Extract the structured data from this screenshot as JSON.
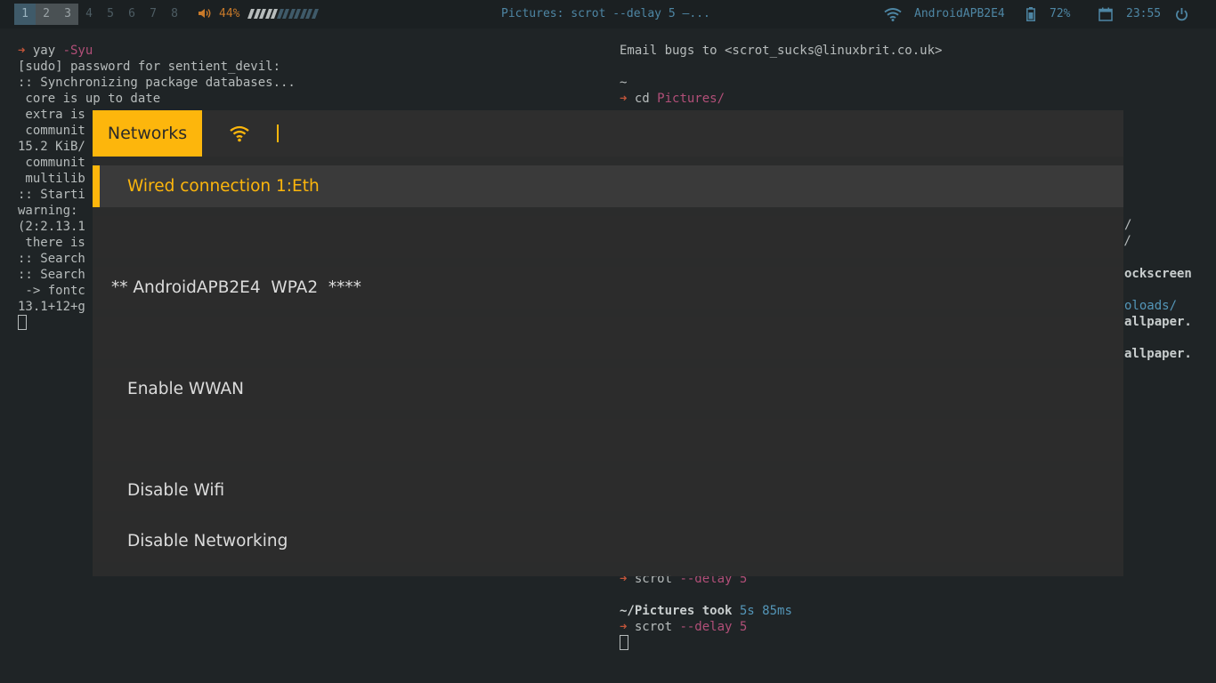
{
  "topbar": {
    "workspaces": [
      "1",
      "2",
      "3",
      "4",
      "5",
      "6",
      "7",
      "8"
    ],
    "volume": "44%",
    "volume_level": 0.44,
    "window_title": "Pictures: scrot --delay 5 —...",
    "ssid": "AndroidAPB2E4",
    "battery": "72%",
    "clock": "23:55",
    "colors": {
      "accent": "#4e86a4",
      "volume": "#c97a2a"
    }
  },
  "term_left": {
    "l1_cmd": "yay ",
    "l1_arg": "-Syu",
    "lines": [
      "[sudo] password for sentient_devil:",
      ":: Synchronizing package databases...",
      " core is up to date",
      " extra is",
      " communit",
      "15.2 KiB/",
      " communit",
      " multilib",
      ":: Starti",
      "warning:",
      "(2:2.13.1",
      " there is",
      ":: Search",
      ":: Search",
      " -> fontc",
      "13.1+12+g"
    ]
  },
  "term_right": {
    "email": "Email bugs to <scrot_sucks@linuxbrit.co.uk>",
    "tilde": "~",
    "cd_cmd": "cd ",
    "cd_arg": "Pictures/",
    "r1": "/",
    "r2": "./",
    "r3": "ockscreen",
    "r4": "oloads/",
    "r5": "allpaper.",
    "r6": "allpaper.",
    "scrot_cmd": "scrot ",
    "scrot_arg": "--delay 5",
    "dir": "~/Pictures",
    "took": " took ",
    "time": "5s 85ms",
    "scrot2_cmd": "scrot ",
    "scrot2_arg": "--delay 5"
  },
  "menu": {
    "prompt": "Networks",
    "items": [
      "Wired connection 1:Eth",
      "",
      "** AndroidAPB2E4  WPA2  ****",
      "",
      "Enable WWAN",
      "",
      "Disable Wifi",
      "Disable Networking"
    ],
    "colors": {
      "highlight": "#fdb60c",
      "background": "#2d2d2d"
    }
  }
}
